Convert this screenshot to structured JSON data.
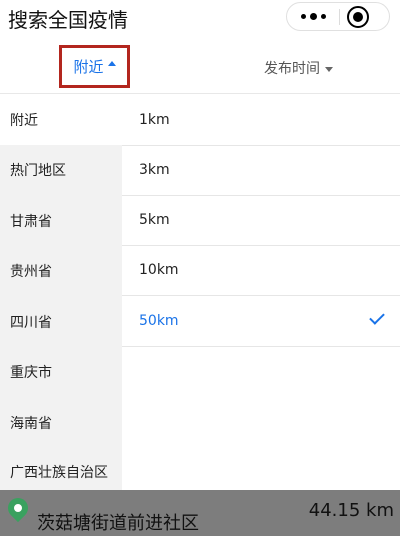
{
  "window": {
    "title": "搜索全国疫情"
  },
  "filter": {
    "nearby_label": "附近",
    "time_label": "发布时间"
  },
  "regions": [
    {
      "label": "附近"
    },
    {
      "label": "热门地区"
    },
    {
      "label": "甘肃省"
    },
    {
      "label": "贵州省"
    },
    {
      "label": "四川省"
    },
    {
      "label": "重庆市"
    },
    {
      "label": "海南省"
    },
    {
      "label": "广西壮族自治区"
    }
  ],
  "distances": [
    {
      "label": "1km"
    },
    {
      "label": "3km"
    },
    {
      "label": "5km"
    },
    {
      "label": "10km"
    },
    {
      "label": "50km",
      "selected": true
    }
  ],
  "location": {
    "name": "茨菇塘街道前进社区",
    "distance": "44.15 km"
  },
  "icons": {
    "more": "more-icon",
    "close": "target-close-icon",
    "check": "checkmark-icon",
    "pin": "location-pin-icon",
    "sort_up": "triangle-up-icon",
    "sort_down": "triangle-down-icon"
  },
  "colors": {
    "accent": "#1a73e8",
    "highlight_box": "#b3261e",
    "sidebar_bg": "#f2f2f2",
    "location_bar_bg": "#7d7d7d",
    "pin": "#3aa15f"
  }
}
